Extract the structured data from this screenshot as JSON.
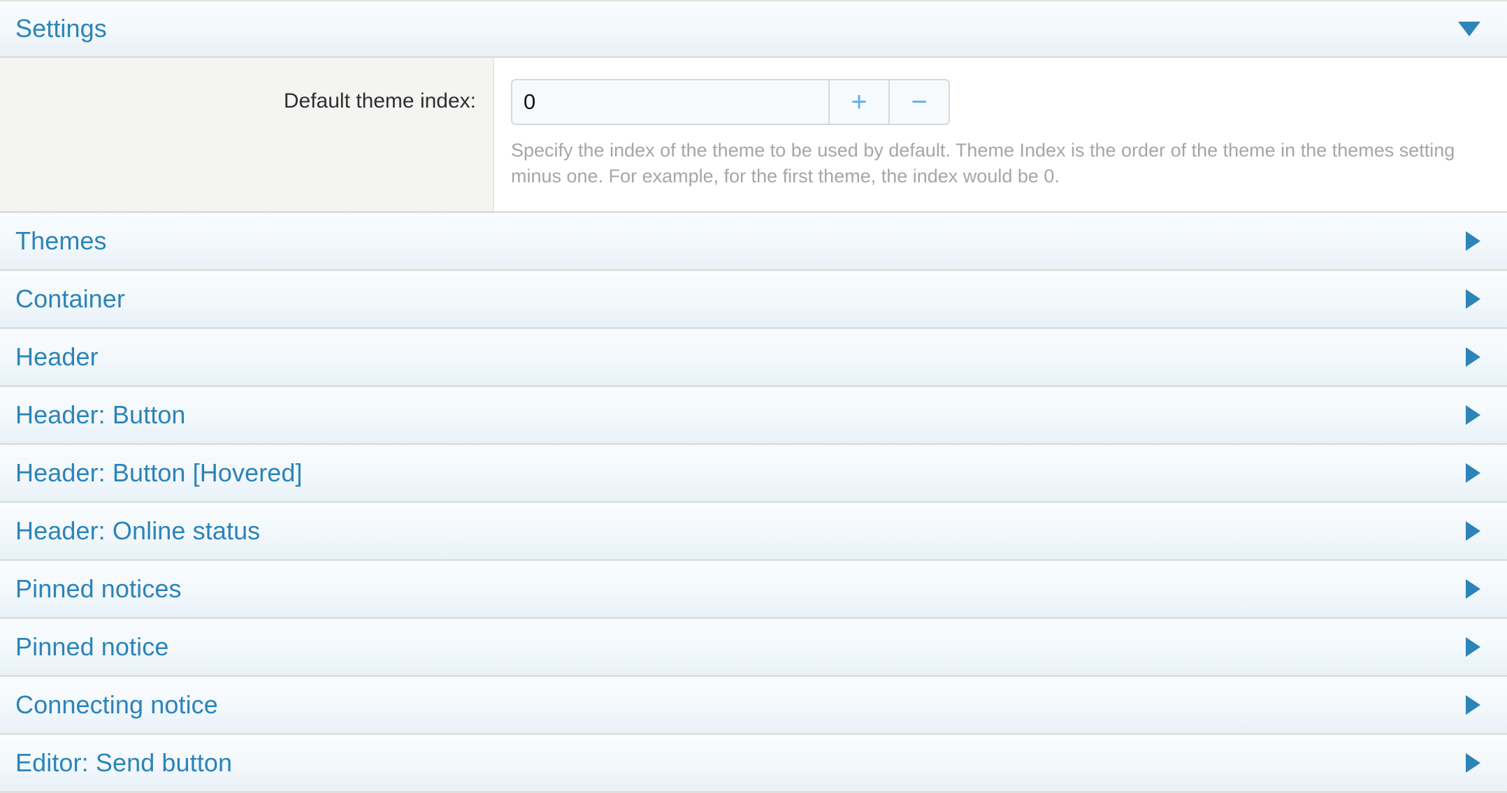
{
  "colors": {
    "accent_blue": "#2c84b8",
    "stepper_blue": "#5cb3ea",
    "label_text": "#2f2f2f",
    "help_text": "#a6a6a6",
    "row_separator": "#dfdfdd",
    "label_column_bg": "#f4f4f3",
    "input_bg": "#f7fafd"
  },
  "settings_section": {
    "title": "Settings",
    "expanded": true,
    "toggle_icon": "chevron-down-icon",
    "field": {
      "label": "Default theme index:",
      "value": "0",
      "placeholder": "",
      "increment_label": "+",
      "decrement_label": "−",
      "help": "Specify the index of the theme to be used by default. Theme Index is the order of the theme in the themes setting minus one. For example, for the first theme, the index would be 0."
    }
  },
  "sections": [
    {
      "label": "Themes",
      "toggle_icon": "chevron-right-icon",
      "expanded": false
    },
    {
      "label": "Container",
      "toggle_icon": "chevron-right-icon",
      "expanded": false
    },
    {
      "label": "Header",
      "toggle_icon": "chevron-right-icon",
      "expanded": false
    },
    {
      "label": "Header: Button",
      "toggle_icon": "chevron-right-icon",
      "expanded": false
    },
    {
      "label": "Header: Button [Hovered]",
      "toggle_icon": "chevron-right-icon",
      "expanded": false
    },
    {
      "label": "Header: Online status",
      "toggle_icon": "chevron-right-icon",
      "expanded": false
    },
    {
      "label": "Pinned notices",
      "toggle_icon": "chevron-right-icon",
      "expanded": false
    },
    {
      "label": "Pinned notice",
      "toggle_icon": "chevron-right-icon",
      "expanded": false
    },
    {
      "label": "Connecting notice",
      "toggle_icon": "chevron-right-icon",
      "expanded": false
    },
    {
      "label": "Editor: Send button",
      "toggle_icon": "chevron-right-icon",
      "expanded": false
    }
  ]
}
